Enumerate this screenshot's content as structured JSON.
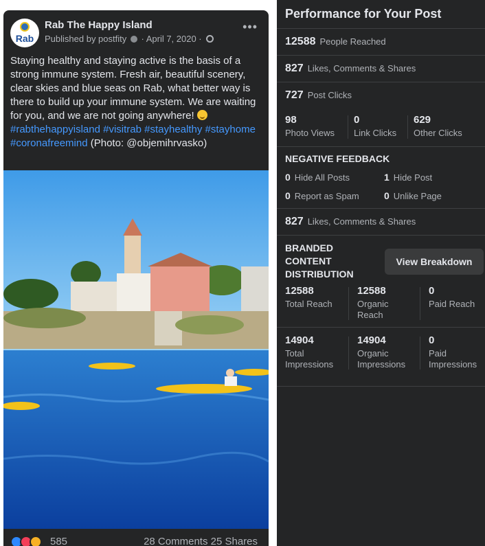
{
  "post": {
    "page_name": "Rab The Happy Island",
    "avatar_text": "Rab",
    "published_by": "Published by postfity",
    "date": "· April 7, 2020 ·",
    "more_icon": "more-icon",
    "text": "Staying healthy and staying active is the basis of a strong immune system. Fresh air, beautiful scenery, clear skies and blue seas on Rab, what better way is there to build up your immune system. We are waiting for you, and we are not going anywhere!",
    "hashtags": [
      "#rabthehappyisland",
      "#visitrab",
      "#stayhealthy",
      "#stayhome",
      "#coronafreemind"
    ],
    "photo_credit": "(Photo: @objemihrvasko)",
    "reaction_count": "585",
    "comments_shares": "28 Comments 25 Shares"
  },
  "panel": {
    "title": "Performance for Your Post",
    "people_reached": {
      "num": "12588",
      "label": "People Reached"
    },
    "engagement": {
      "num": "827",
      "label": "Likes, Comments & Shares"
    },
    "post_clicks": {
      "num": "727",
      "label": "Post Clicks"
    },
    "clicks": [
      {
        "num": "98",
        "label": "Photo Views"
      },
      {
        "num": "0",
        "label": "Link Clicks"
      },
      {
        "num": "629",
        "label": "Other Clicks"
      }
    ],
    "negative_title": "NEGATIVE FEEDBACK",
    "negative": [
      {
        "num": "0",
        "label": "Hide All Posts"
      },
      {
        "num": "1",
        "label": "Hide Post"
      },
      {
        "num": "0",
        "label": "Report as Spam"
      },
      {
        "num": "0",
        "label": "Unlike Page"
      }
    ],
    "engagement2": {
      "num": "827",
      "label": "Likes, Comments & Shares"
    },
    "branded_title_lines": [
      "BRANDED",
      "CONTENT",
      "DISTRIBUTION"
    ],
    "view_breakdown": "View Breakdown",
    "reach": [
      {
        "num": "12588",
        "label": "Total Reach"
      },
      {
        "num": "12588",
        "label": "Organic Reach"
      },
      {
        "num": "0",
        "label": "Paid Reach"
      }
    ],
    "impressions": [
      {
        "num": "14904",
        "label": "Total Impressions"
      },
      {
        "num": "14904",
        "label": "Organic Impressions"
      },
      {
        "num": "0",
        "label": "Paid Impressions"
      }
    ]
  },
  "colors": {
    "bg_dark": "#242526",
    "text_primary": "#e4e6eb",
    "text_secondary": "#b0b3b8",
    "link": "#4599ff"
  }
}
